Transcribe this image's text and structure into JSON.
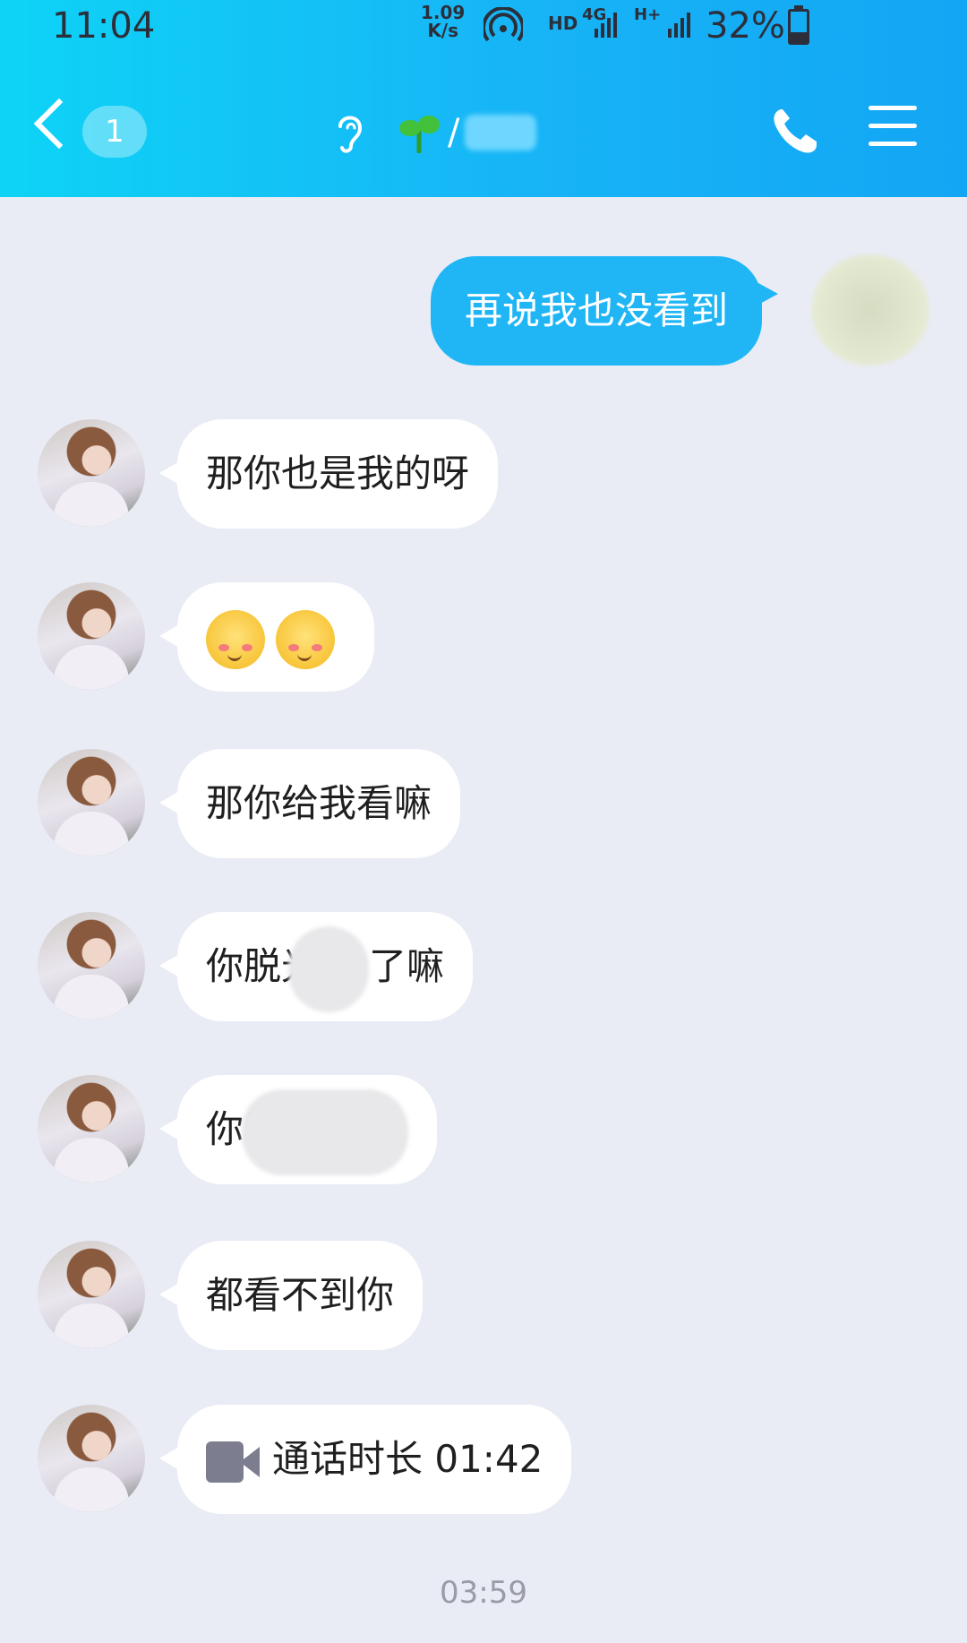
{
  "status_bar": {
    "time": "11:04",
    "speed_value": "1.09",
    "speed_unit": "K/s",
    "hd": "HD",
    "net_4g": "4G",
    "net_hplus": "H+",
    "battery_text": "32%",
    "battery_level": 0.32
  },
  "header": {
    "back_count": "1",
    "contact_name": "/",
    "icons": [
      "back-icon",
      "ear-icon",
      "sprout-icon",
      "phone-icon",
      "menu-icon"
    ]
  },
  "messages": [
    {
      "side": "sent",
      "text": "再说我也没看到"
    },
    {
      "side": "received",
      "text": "那你也是我的呀"
    },
    {
      "side": "received",
      "type": "emoji",
      "emoji_count": 2
    },
    {
      "side": "received",
      "text": "那你给我看嘛"
    },
    {
      "side": "received",
      "text_before": "你脱光",
      "text_after": "了嘛"
    },
    {
      "side": "received",
      "text_before": "你看"
    },
    {
      "side": "received",
      "text": "都看不到你"
    },
    {
      "side": "received",
      "type": "call",
      "text": "通话时长 01:42"
    }
  ],
  "footer_time": "03:59",
  "colors": {
    "header_gradient_start": "#0ed3f6",
    "header_gradient_end": "#13a6f4",
    "sent_bubble": "#20b6f6",
    "received_bubble": "#ffffff",
    "background": "#e9ecf5"
  }
}
